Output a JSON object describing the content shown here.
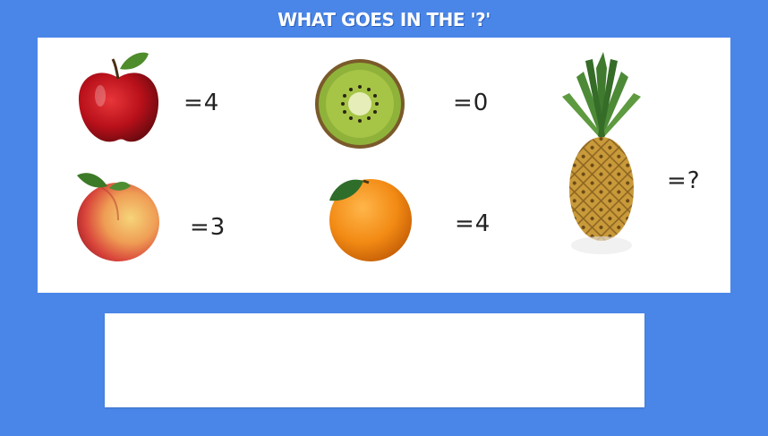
{
  "title": "WHAT GOES IN THE '?'",
  "puzzle": {
    "items": [
      {
        "fruit": "apple",
        "icon": "apple-icon",
        "value": "=4"
      },
      {
        "fruit": "kiwi",
        "icon": "kiwi-icon",
        "value": "=0"
      },
      {
        "fruit": "peach",
        "icon": "peach-icon",
        "value": "=3"
      },
      {
        "fruit": "orange",
        "icon": "orange-icon",
        "value": "=4"
      },
      {
        "fruit": "pineapple",
        "icon": "pineapple-icon",
        "value": "=?"
      }
    ]
  },
  "answer": {
    "value": "",
    "placeholder": ""
  },
  "colors": {
    "background": "#4a86e8",
    "panel": "#ffffff"
  }
}
